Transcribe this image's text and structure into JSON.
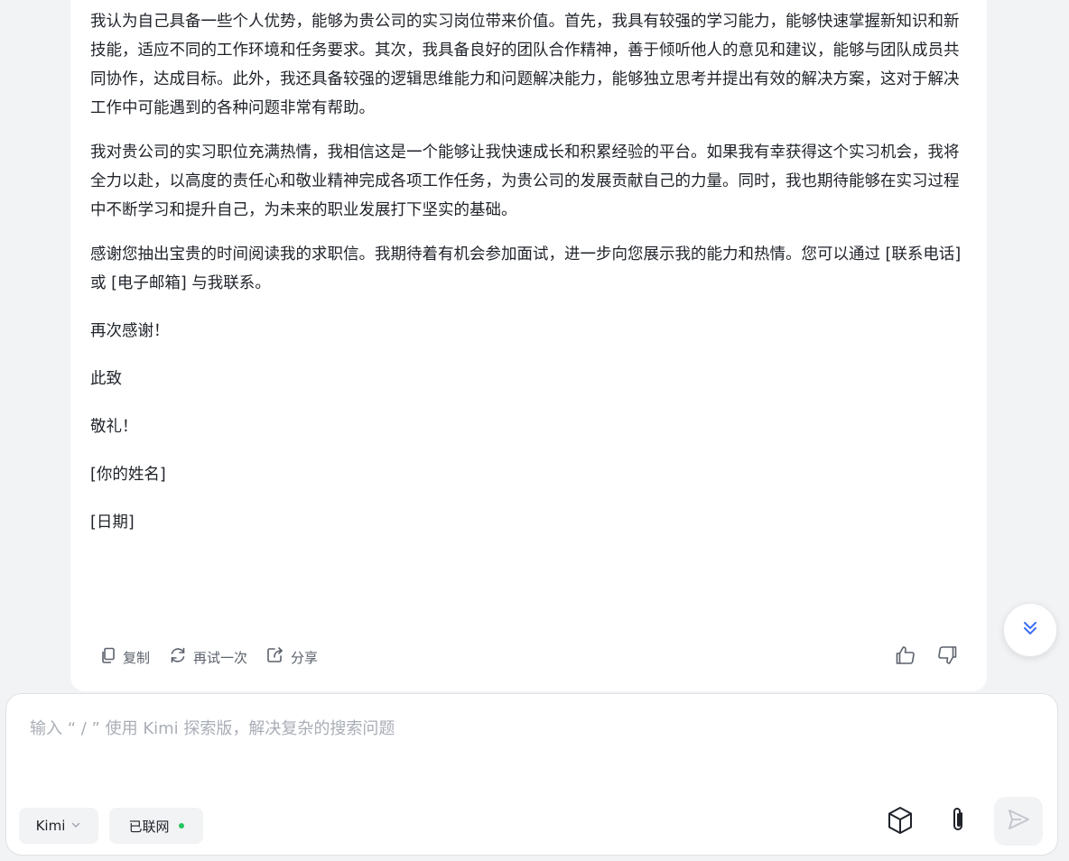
{
  "message": {
    "paragraphs": [
      "我认为自己具备一些个人优势，能够为贵公司的实习岗位带来价值。首先，我具有较强的学习能力，能够快速掌握新知识和新技能，适应不同的工作环境和任务要求。其次，我具备良好的团队合作精神，善于倾听他人的意见和建议，能够与团队成员共同协作，达成目标。此外，我还具备较强的逻辑思维能力和问题解决能力，能够独立思考并提出有效的解决方案，这对于解决工作中可能遇到的各种问题非常有帮助。",
      "我对贵公司的实习职位充满热情，我相信这是一个能够让我快速成长和积累经验的平台。如果我有幸获得这个实习机会，我将全力以赴，以高度的责任心和敬业精神完成各项工作任务，为贵公司的发展贡献自己的力量。同时，我也期待能够在实习过程中不断学习和提升自己，为未来的职业发展打下坚实的基础。",
      "感谢您抽出宝贵的时间阅读我的求职信。我期待着有机会参加面试，进一步向您展示我的能力和热情。您可以通过 [联系电话] 或 [电子邮箱] 与我联系。"
    ],
    "closing": {
      "thanks": "再次感谢！",
      "regards": "此致",
      "salute": "敬礼！",
      "name": "[你的姓名]",
      "date": "[日期]"
    }
  },
  "actions": {
    "copy": "复制",
    "retry": "再试一次",
    "share": "分享"
  },
  "composer": {
    "placeholder": "输入 “ / ” 使用 Kimi 探索版，解决复杂的搜索问题",
    "model": "Kimi",
    "network_status": "已联网",
    "network_color": "#22c55e"
  },
  "icons": {
    "copy": "copy-icon",
    "retry": "refresh-icon",
    "share": "share-icon",
    "like": "thumbs-up-icon",
    "dislike": "thumbs-down-icon",
    "scroll": "double-chevron-down-icon",
    "chevron": "chevron-down-icon",
    "toolbox": "cube-icon",
    "attach": "paperclip-icon",
    "send": "send-icon"
  },
  "colors": {
    "accent": "#3b6ef5",
    "background": "#f2f3f5"
  }
}
